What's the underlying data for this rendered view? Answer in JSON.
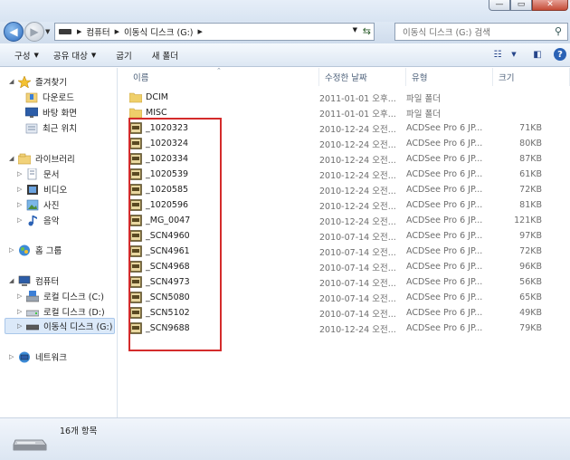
{
  "address": {
    "crumbs": [
      "컴퓨터",
      "이동식 디스크 (G:)"
    ],
    "search_placeholder": "이동식 디스크 (G:) 검색"
  },
  "toolbar": {
    "organize": "구성",
    "share": "공유 대상",
    "burn": "굽기",
    "new_folder": "새 폴더"
  },
  "nav": {
    "favorites": "즐겨찾기",
    "downloads": "다운로드",
    "desktop": "바탕 화면",
    "recent": "최근 위치",
    "libraries": "라이브러리",
    "documents": "문서",
    "videos": "비디오",
    "pictures": "사진",
    "music": "음악",
    "homegroup": "홈 그룹",
    "computer": "컴퓨터",
    "local_c": "로컬 디스크 (C:)",
    "local_d": "로컬 디스크 (D:)",
    "removable_g": "이동식 디스크 (G:)",
    "network": "네트워크"
  },
  "columns": {
    "name": "이름",
    "date": "수정한 날짜",
    "type": "유형",
    "size": "크기"
  },
  "files": [
    {
      "name": "DCIM",
      "date": "2011-01-01 오후...",
      "type": "파일 폴더",
      "size": "",
      "kind": "folder"
    },
    {
      "name": "MISC",
      "date": "2011-01-01 오후...",
      "type": "파일 폴더",
      "size": "",
      "kind": "folder"
    },
    {
      "name": "_1020323",
      "date": "2010-12-24 오전...",
      "type": "ACDSee Pro 6 JP...",
      "size": "71KB",
      "kind": "jpg"
    },
    {
      "name": "_1020324",
      "date": "2010-12-24 오전...",
      "type": "ACDSee Pro 6 JP...",
      "size": "80KB",
      "kind": "jpg"
    },
    {
      "name": "_1020334",
      "date": "2010-12-24 오전...",
      "type": "ACDSee Pro 6 JP...",
      "size": "87KB",
      "kind": "jpg"
    },
    {
      "name": "_1020539",
      "date": "2010-12-24 오전...",
      "type": "ACDSee Pro 6 JP...",
      "size": "61KB",
      "kind": "jpg"
    },
    {
      "name": "_1020585",
      "date": "2010-12-24 오전...",
      "type": "ACDSee Pro 6 JP...",
      "size": "72KB",
      "kind": "jpg"
    },
    {
      "name": "_1020596",
      "date": "2010-12-24 오전...",
      "type": "ACDSee Pro 6 JP...",
      "size": "81KB",
      "kind": "jpg"
    },
    {
      "name": "_MG_0047",
      "date": "2010-12-24 오전...",
      "type": "ACDSee Pro 6 JP...",
      "size": "121KB",
      "kind": "jpg"
    },
    {
      "name": "_SCN4960",
      "date": "2010-07-14 오전...",
      "type": "ACDSee Pro 6 JP...",
      "size": "97KB",
      "kind": "jpg"
    },
    {
      "name": "_SCN4961",
      "date": "2010-07-14 오전...",
      "type": "ACDSee Pro 6 JP...",
      "size": "72KB",
      "kind": "jpg"
    },
    {
      "name": "_SCN4968",
      "date": "2010-07-14 오전...",
      "type": "ACDSee Pro 6 JP...",
      "size": "96KB",
      "kind": "jpg"
    },
    {
      "name": "_SCN4973",
      "date": "2010-07-14 오전...",
      "type": "ACDSee Pro 6 JP...",
      "size": "56KB",
      "kind": "jpg"
    },
    {
      "name": "_SCN5080",
      "date": "2010-07-14 오전...",
      "type": "ACDSee Pro 6 JP...",
      "size": "65KB",
      "kind": "jpg"
    },
    {
      "name": "_SCN5102",
      "date": "2010-07-14 오전...",
      "type": "ACDSee Pro 6 JP...",
      "size": "49KB",
      "kind": "jpg"
    },
    {
      "name": "_SCN9688",
      "date": "2010-12-24 오전...",
      "type": "ACDSee Pro 6 JP...",
      "size": "79KB",
      "kind": "jpg"
    }
  ],
  "status": {
    "item_count": "16개 항목"
  },
  "colors": {
    "highlight": "#d42b2b",
    "selection": "#dbe9f9"
  }
}
